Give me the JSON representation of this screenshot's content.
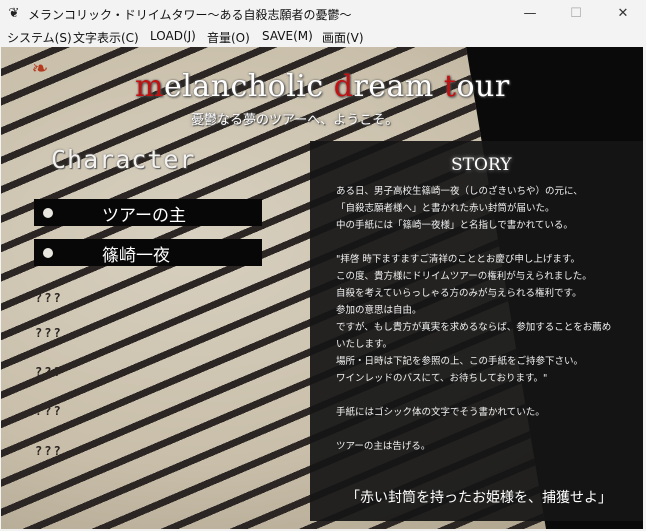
{
  "window": {
    "title": "メランコリック・ドリイムタワー〜ある自殺志願者の憂鬱〜",
    "app_icon": "butterfly-icon",
    "minimize_glyph": "—",
    "maximize_glyph": "☐",
    "close_glyph": "✕"
  },
  "menu": {
    "items": [
      "システム(S)",
      "文字表示(C)",
      "LOAD(J)",
      "音量(O)",
      "SAVE(M)",
      "画面(V)"
    ]
  },
  "game": {
    "title_parts": [
      {
        "text": "m",
        "red": true
      },
      {
        "text": "elancholic ",
        "red": false
      },
      {
        "text": "d",
        "red": true
      },
      {
        "text": "ream ",
        "red": false
      },
      {
        "text": "t",
        "red": true
      },
      {
        "text": "our",
        "red": false
      }
    ],
    "subtitle": "憂鬱なる夢のツアーへ、ようこそ。",
    "character_heading": "Character",
    "characters": [
      "ツアーの主",
      "篠崎一夜"
    ],
    "locked_entries": [
      "???",
      "???",
      "???",
      "???",
      "???"
    ],
    "story": {
      "heading": "STORY",
      "lines": [
        "ある日、男子高校生篠崎一夜（しのざきいちや）の元に、",
        "「自殺志願者様へ」と書かれた赤い封筒が届いた。",
        "中の手紙には「篠崎一夜様」と名指しで書かれている。",
        "",
        "\"拝啓 時下ますますご清祥のこととお慶び申し上げます。",
        "この度、貴方様にドリイムツアーの権利が与えられました。",
        "自殺を考えていらっしゃる方のみが与えられる権利です。",
        "参加の意思は自由。",
        "ですが、もし貴方が真実を求めるならば、参加することをお薦め",
        "いたします。",
        "場所・日時は下記を参照の上、この手紙をご持参下さい。",
        "ワインレッドのバスにて、お待ちしております。\"",
        "",
        "手紙にはゴシック体の文字でそう書かれていた。",
        "",
        "ツアーの主は告げる。"
      ],
      "tagline": "「赤い封筒を持ったお姫様を、捕獲せよ」"
    }
  },
  "colors": {
    "accent_red": "#c41010",
    "panel": "#161616",
    "stripe": "#2b2623"
  }
}
